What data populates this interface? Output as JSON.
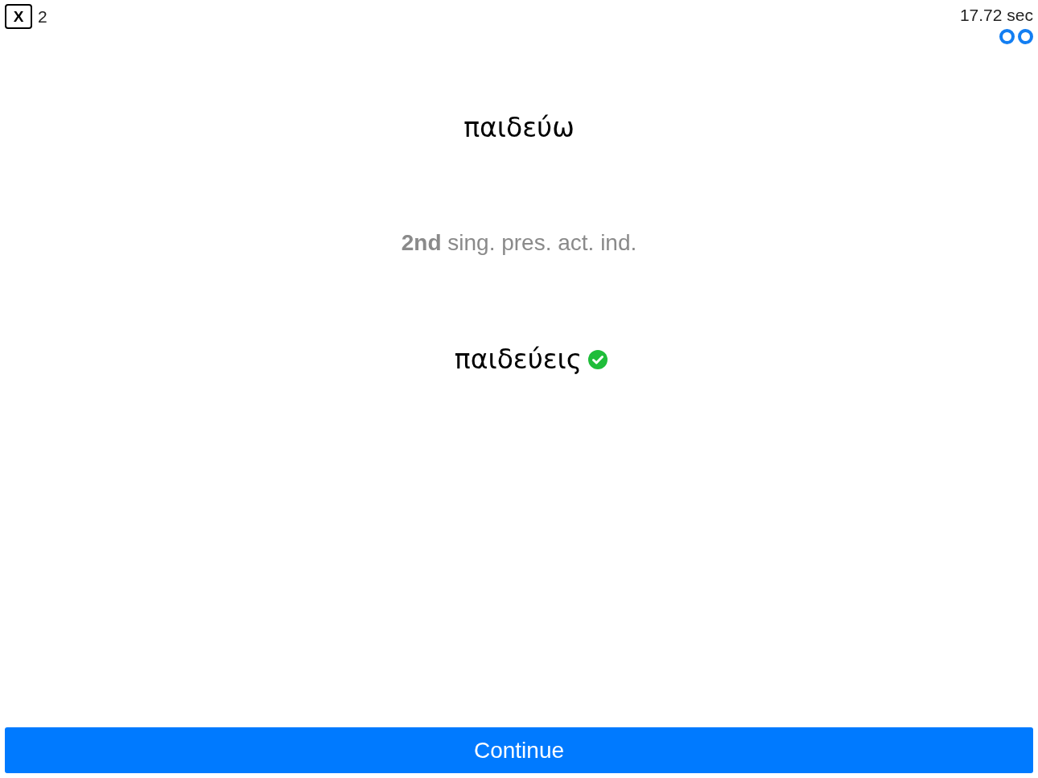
{
  "close_button": {
    "label": "X"
  },
  "count": "2",
  "timer": "17.72 sec",
  "progress_dots": [
    {
      "filled": false
    },
    {
      "filled": false
    }
  ],
  "lemma": "παιδεύω",
  "parse": "**2nd** sing. pres. act. ind.",
  "answer": {
    "text": "παιδεύεις",
    "correct": true
  },
  "continue_button": {
    "label": "Continue"
  }
}
